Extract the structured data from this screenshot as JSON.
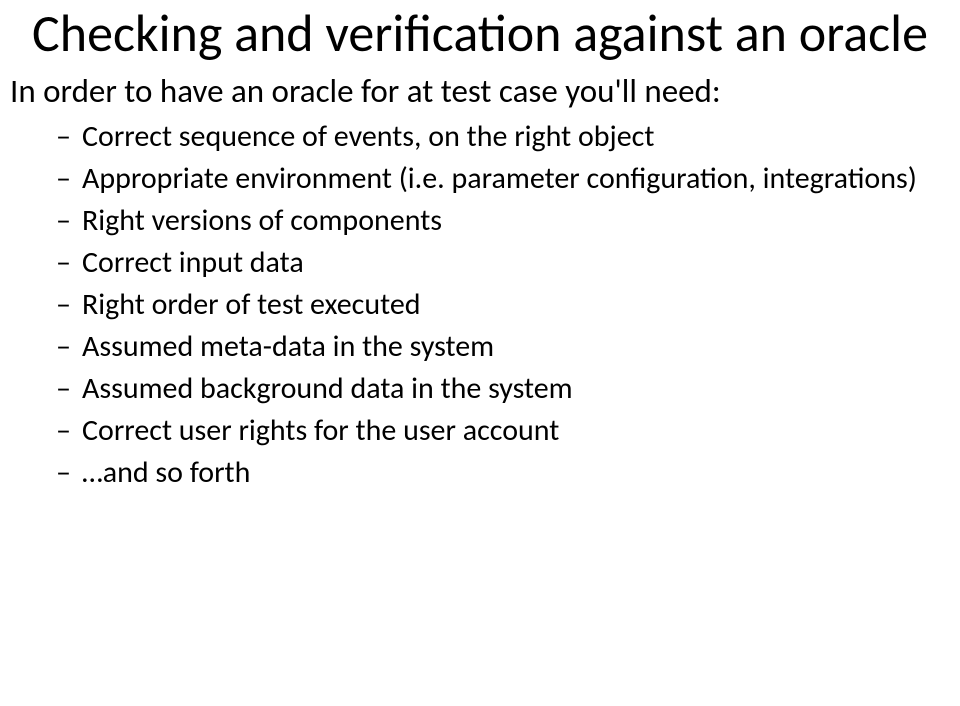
{
  "title": "Checking and verification against an oracle",
  "intro": "In order to have an oracle for at test case you'll need:",
  "items": [
    "Correct sequence of events, on the right object",
    "Appropriate environment (i.e. parameter configuration, integrations)",
    "Right versions of components",
    "Correct input data",
    "Right order of test executed",
    "Assumed meta-data in the system",
    "Assumed background data in the system",
    "Correct user rights for the user account",
    "…and so forth"
  ]
}
